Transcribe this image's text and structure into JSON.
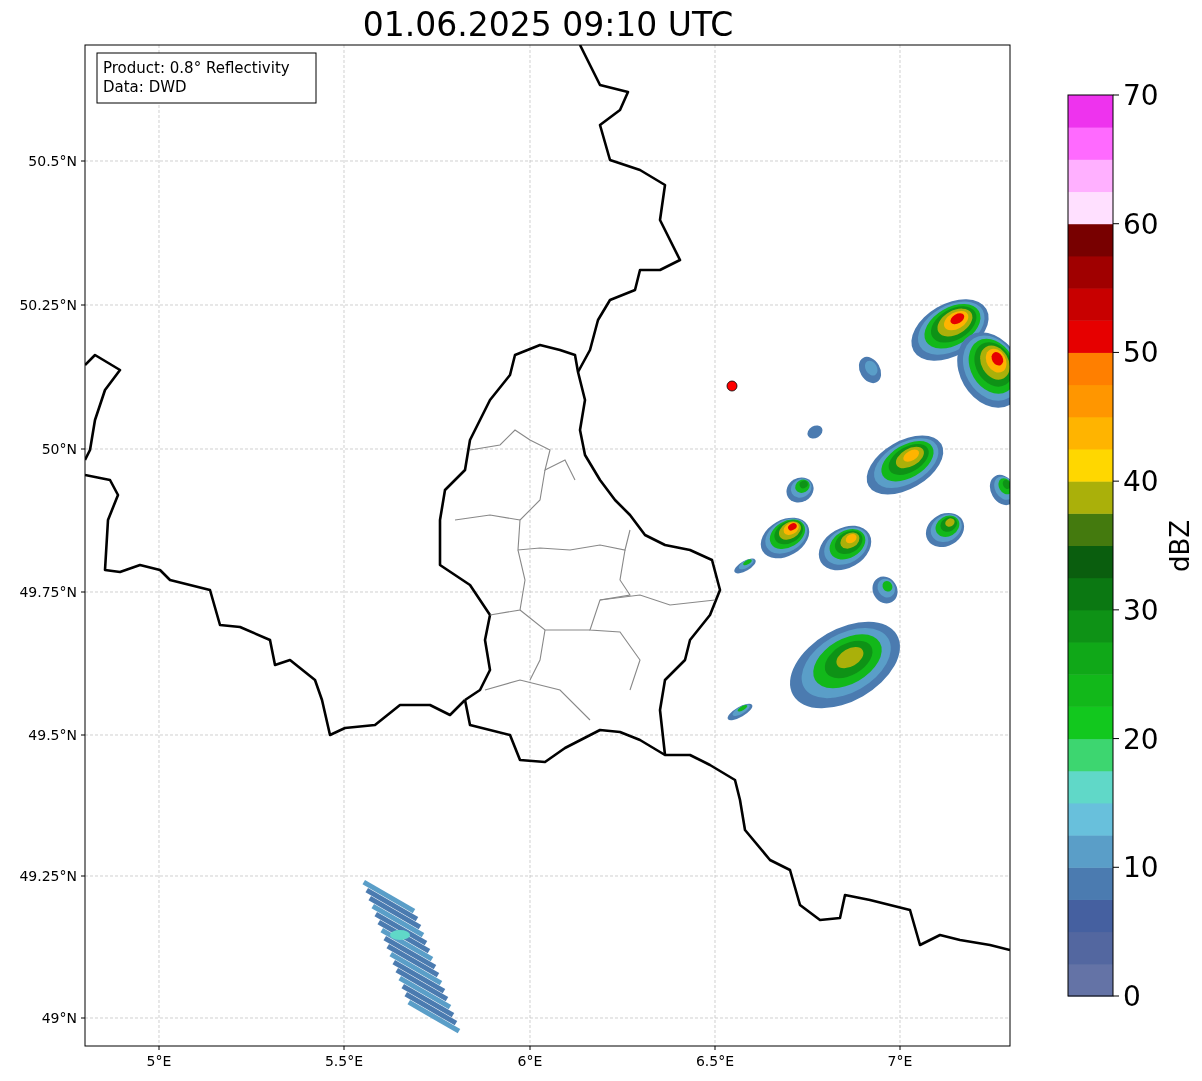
{
  "title": "01.06.2025 09:10 UTC",
  "info_box": [
    "Product: 0.8° Reflectivity",
    "Data: DWD"
  ],
  "y_ticks": [
    "50.5°N",
    "50.25°N",
    "50°N",
    "49.75°N",
    "49.5°N",
    "49.25°N",
    "49°N"
  ],
  "x_ticks": [
    "5°E",
    "5.5°E",
    "6°E",
    "6.5°E",
    "7°E"
  ],
  "colorbar": {
    "label": "dBZ",
    "ticks": [
      "70",
      "60",
      "50",
      "40",
      "30",
      "20",
      "10",
      "0"
    ],
    "segments": [
      {
        "color": "#6473a6"
      },
      {
        "color": "#5367a0"
      },
      {
        "color": "#4560a0"
      },
      {
        "color": "#4b7bb0"
      },
      {
        "color": "#5a9ec8"
      },
      {
        "color": "#68c0dc"
      },
      {
        "color": "#60d8c8"
      },
      {
        "color": "#3dd670"
      },
      {
        "color": "#12c81e"
      },
      {
        "color": "#12b81a"
      },
      {
        "color": "#10a818"
      },
      {
        "color": "#0e9216"
      },
      {
        "color": "#0b7812"
      },
      {
        "color": "#0a5e0e"
      },
      {
        "color": "#447a0e"
      },
      {
        "color": "#aab00a"
      },
      {
        "color": "#ffd700"
      },
      {
        "color": "#ffb400"
      },
      {
        "color": "#ff9600"
      },
      {
        "color": "#ff7f00"
      },
      {
        "color": "#e60000"
      },
      {
        "color": "#c80000"
      },
      {
        "color": "#a00000"
      },
      {
        "color": "#780000"
      },
      {
        "color": "#ffe0ff"
      },
      {
        "color": "#ffb0ff"
      },
      {
        "color": "#ff6aff"
      },
      {
        "color": "#ee33ee"
      }
    ]
  }
}
